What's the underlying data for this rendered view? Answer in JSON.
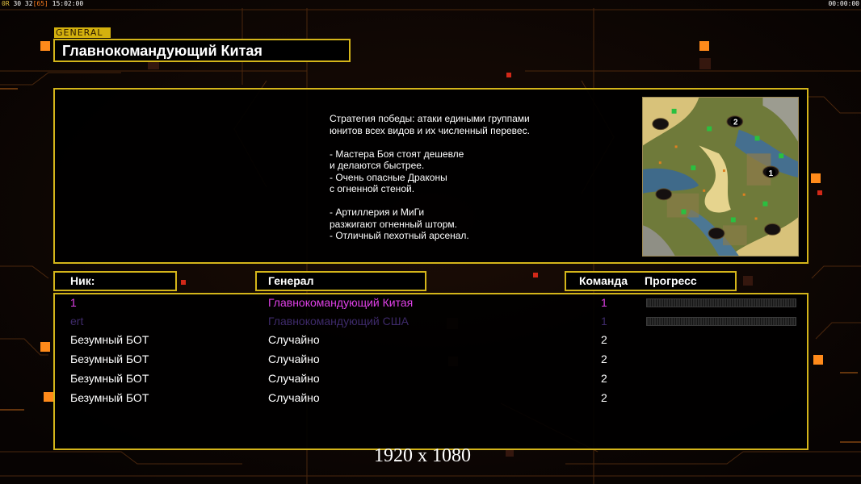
{
  "hud": {
    "tl_a": "0R",
    "tl_b": "30 32",
    "tl_c": "[65]",
    "tl_d": "15:02:00",
    "tr": "00:00:00"
  },
  "general_tag": "GENERAL",
  "title": "Главнокомандующий Китая",
  "description": "Стратегия победы: атаки едиными группами\nюнитов всех видов и их численный перевес.\n\n- Мастера Боя стоят дешевле\nи делаются быстрее.\n- Очень опасные Драконы\nс огненной стеной.\n\n- Артиллерия и МиГи\nразжигают огненный шторм.\n- Отличный пехотный арсенал.",
  "map_markers": [
    "1",
    "2"
  ],
  "columns": {
    "nick": "Ник:",
    "general": "Генерал",
    "team": "Команда",
    "progress": "Прогресс"
  },
  "players": [
    {
      "nick": "1",
      "general": "Главнокомандующий Китая",
      "team": "1",
      "color": "#e040e8",
      "progress": 0
    },
    {
      "nick": "ert",
      "general": "Главнокомандующий США",
      "team": "1",
      "color": "#3e2a6a",
      "progress": 0
    },
    {
      "nick": "Безумный БОТ",
      "general": "Случайно",
      "team": "2",
      "color": "#ffffff"
    },
    {
      "nick": "Безумный БОТ",
      "general": "Случайно",
      "team": "2",
      "color": "#ffffff"
    },
    {
      "nick": "Безумный БОТ",
      "general": "Случайно",
      "team": "2",
      "color": "#ffffff"
    },
    {
      "nick": "Безумный БОТ",
      "general": "Случайно",
      "team": "2",
      "color": "#ffffff"
    }
  ],
  "resolution": "1920 x 1080",
  "colors": {
    "accent": "#d4b51a",
    "highlight": "#ff8a1a"
  }
}
